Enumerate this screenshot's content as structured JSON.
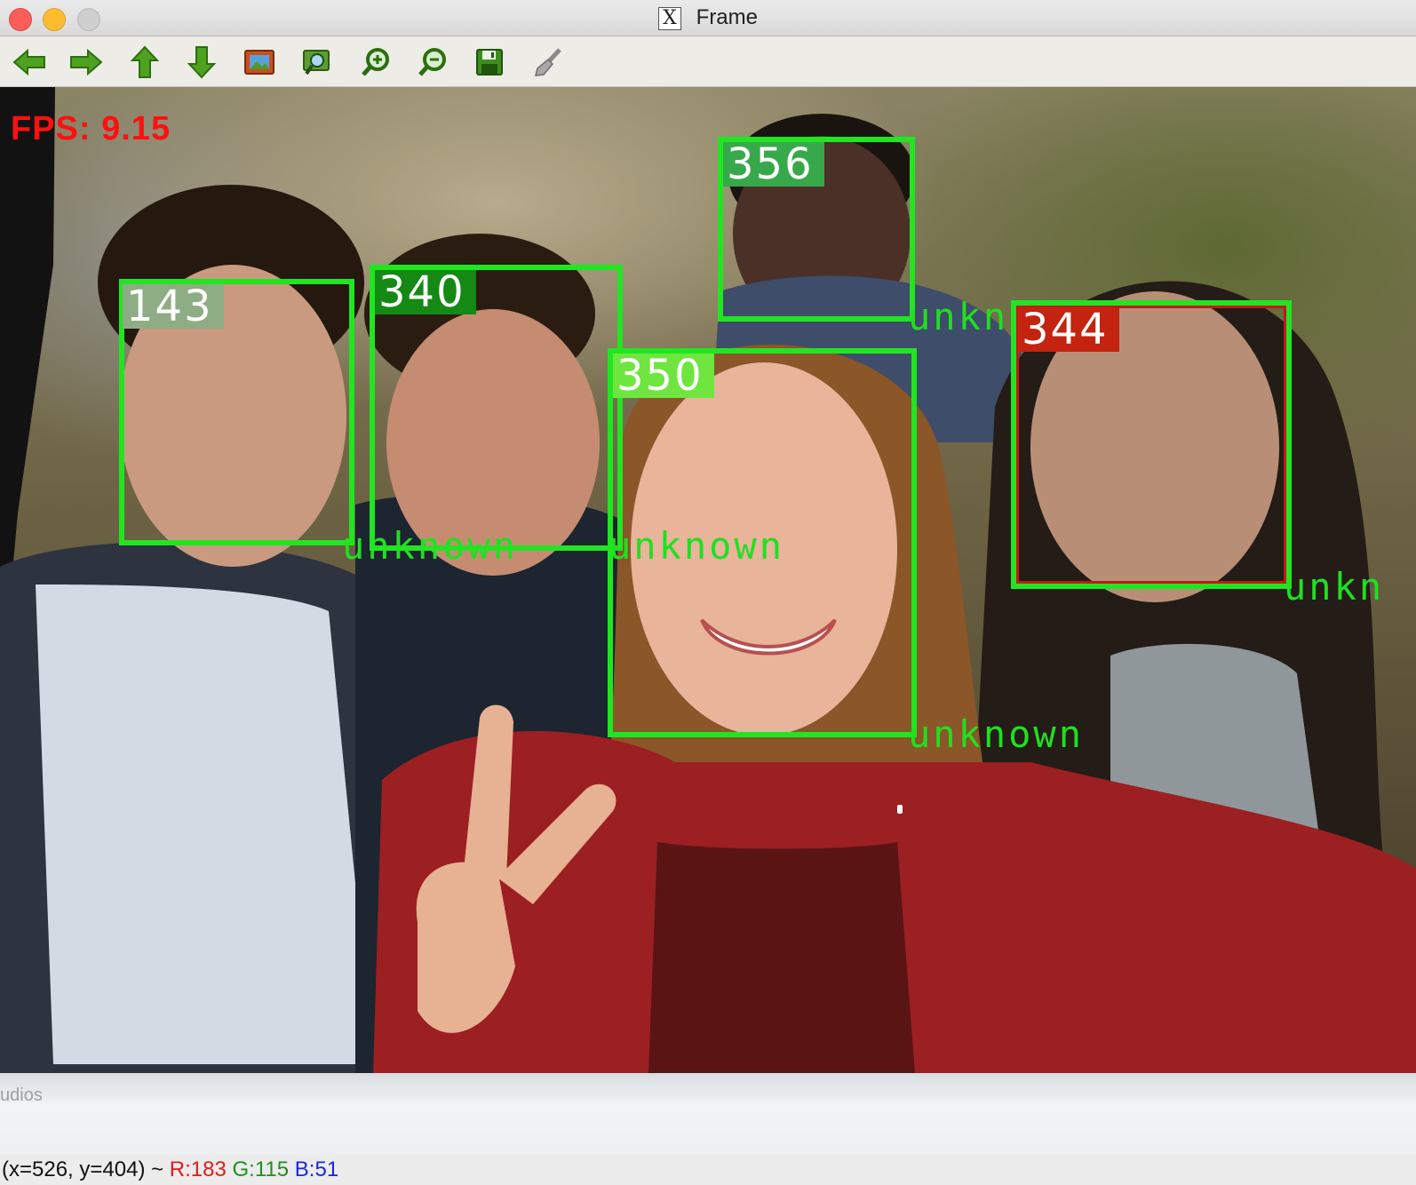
{
  "window": {
    "title": "Frame"
  },
  "toolbar": {
    "buttons": [
      {
        "name": "pan-left-icon"
      },
      {
        "name": "pan-right-icon"
      },
      {
        "name": "pan-up-icon"
      },
      {
        "name": "pan-down-icon"
      },
      {
        "name": "zoom-fit-icon"
      },
      {
        "name": "zoom-region-icon"
      },
      {
        "name": "zoom-in-icon"
      },
      {
        "name": "zoom-out-icon"
      },
      {
        "name": "save-icon"
      },
      {
        "name": "properties-icon"
      }
    ]
  },
  "overlay": {
    "fps": "FPS: 9.15",
    "faces": [
      {
        "id": "143",
        "name": "unknown",
        "label_color": "#8fad84"
      },
      {
        "id": "340",
        "name": "unknown",
        "label_color": "#148a14"
      },
      {
        "id": "356",
        "name": "unknown",
        "label_color": "#38a94a"
      },
      {
        "id": "350",
        "name": "unknown",
        "label_color": "#6fe63f"
      },
      {
        "id": "344",
        "name": "unkn",
        "label_color": "#c4230f"
      }
    ],
    "watermark": "udios"
  },
  "status": {
    "coords": "(x=526, y=404) ~ ",
    "r": "R:183",
    "g": "G:115",
    "b": "B:51"
  },
  "colors": {
    "box": "#22e522",
    "fps": "#ff1010",
    "name": "#20e020"
  }
}
